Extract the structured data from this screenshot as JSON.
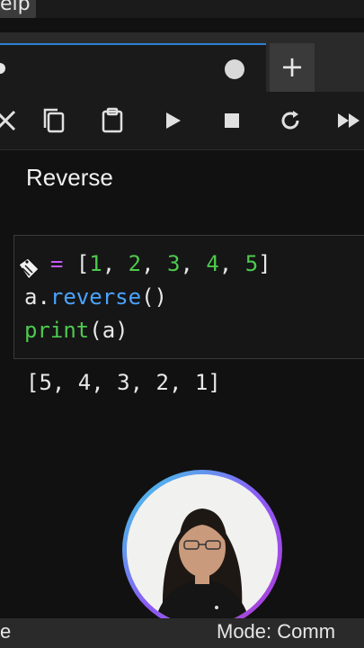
{
  "menubar": {
    "help_label": "elp"
  },
  "tabbar": {
    "new_tab_label": "+"
  },
  "toolbar": {
    "icons": [
      "cut-icon",
      "copy-icon",
      "paste-icon",
      "run-icon",
      "stop-icon",
      "restart-icon",
      "fast-forward-icon"
    ]
  },
  "markdown": {
    "text": "Reverse"
  },
  "code": {
    "line1": {
      "assign": "=",
      "open": "[",
      "n1": "1",
      "c1": ", ",
      "n2": "2",
      "c2": ", ",
      "n3": "3",
      "c3": ", ",
      "n4": "4",
      "c4": ", ",
      "n5": "5",
      "close": "]"
    },
    "line2": {
      "obj": "a",
      "dot": ".",
      "method": "reverse",
      "parens": "()"
    },
    "line3": {
      "fn": "print",
      "args": "(a)"
    }
  },
  "output": {
    "text": "[5, 4, 3, 2, 1]"
  },
  "status": {
    "left": "e",
    "mode": "Mode: Comm"
  },
  "colors": {
    "accent": "#2d7fd6",
    "keyword": "#4ec94e",
    "operator": "#c757ff",
    "method": "#4aa3ff"
  }
}
